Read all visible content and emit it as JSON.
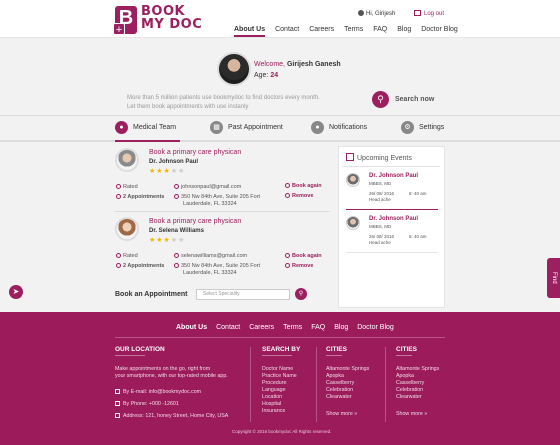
{
  "brand": {
    "line1": "BOOK",
    "line2": "MY DOC",
    "mark": "B",
    "accent": "#9c1f5f"
  },
  "header": {
    "greeting": "Hi, Girijesh",
    "logout": "Log out",
    "nav": [
      "About Us",
      "Contact",
      "Careers",
      "Terms",
      "FAQ",
      "Blog",
      "Doctor Blog"
    ],
    "active_nav": "About Us"
  },
  "profile": {
    "welcome": "Welcome,",
    "name": "Girijesh Ganesh",
    "age_label": "Age:",
    "age": "24"
  },
  "promo": {
    "line1": "More than 5 million patients use bookmydoc to find doctors  every month.",
    "line2": "Let them book appointments with use instanly",
    "search_label": "Search now"
  },
  "tabs": [
    {
      "label": "Medical Team",
      "icon": "doctor-icon"
    },
    {
      "label": "Past Appointment",
      "icon": "calendar-icon"
    },
    {
      "label": "Notifications",
      "icon": "bell-icon"
    },
    {
      "label": "Settings",
      "icon": "gear-icon"
    }
  ],
  "doctors": [
    {
      "title": "Book a primary care physican",
      "name": "Dr. Johnson Paul",
      "rating": 3,
      "status": "Rated",
      "appointments": "2 Appointments",
      "email": "johnsonpaul@gmail.com",
      "address1": "350 Nw 84th Ave, Suite 205 Fort",
      "address2": "Lauderdale, FL 33324",
      "book_again": "Book again",
      "remove": "Remove"
    },
    {
      "title": "Book a primary care physican",
      "name": "Dr. Selena Williams",
      "rating": 3,
      "status": "Rated",
      "appointments": "2 Appointments",
      "email": "selenawilliams@gmail.com",
      "address1": "350 Nw 84th Ave, Suite 205 Fort",
      "address2": "Lauderdale, FL 33324",
      "book_again": "Book again",
      "remove": "Remove"
    }
  ],
  "book_appointment": {
    "label": "Book an Appointment",
    "placeholder": "Select Speciality"
  },
  "upcoming": {
    "title": "Upcoming Events",
    "events": [
      {
        "name": "Dr. Johnson Paul",
        "degree": "MBBS, MD",
        "date": "26/ 08/ 2016",
        "time": "8: 40 am",
        "note": "Head ache"
      },
      {
        "name": "Dr. Johnson Paul",
        "degree": "MBBS, MD",
        "date": "26/ 08/ 2016",
        "time": "8: 40 am",
        "note": "Head ache"
      }
    ]
  },
  "side": {
    "find": "Find"
  },
  "footer": {
    "nav": [
      "About Us",
      "Contact",
      "Careers",
      "Terms",
      "FAQ",
      "Blog",
      "Doctor Blog"
    ],
    "location": {
      "title": "OUR LOCATION",
      "text1": "Make appointments on the go, right from",
      "text2": "your smartphone, with our top-rated mobile app.",
      "email": "By E-mail: info@bookmydoc.com",
      "phone": "By Phone: +000 -12601",
      "address": "Address: 121, honey Street, Home City, USA"
    },
    "search_by": {
      "title": "SEARCH BY",
      "items": [
        "Doctor Name",
        "Practice Name",
        "Procedure",
        "Language",
        "Location",
        "Hospital",
        "Insurance"
      ]
    },
    "cities1": {
      "title": "CITIES",
      "items": [
        "Altamonte Springs",
        "Apopka",
        "Casselberry",
        "Celebration",
        "Clearwater"
      ],
      "more": "Show more"
    },
    "cities2": {
      "title": "CITIES",
      "items": [
        "Altamonte Springs",
        "Apopka",
        "Casselberry",
        "Celebration",
        "Clearwater"
      ],
      "more": "Show more"
    },
    "copyright": "Copyright © 2016 bookmydoc All Rights reserved."
  }
}
